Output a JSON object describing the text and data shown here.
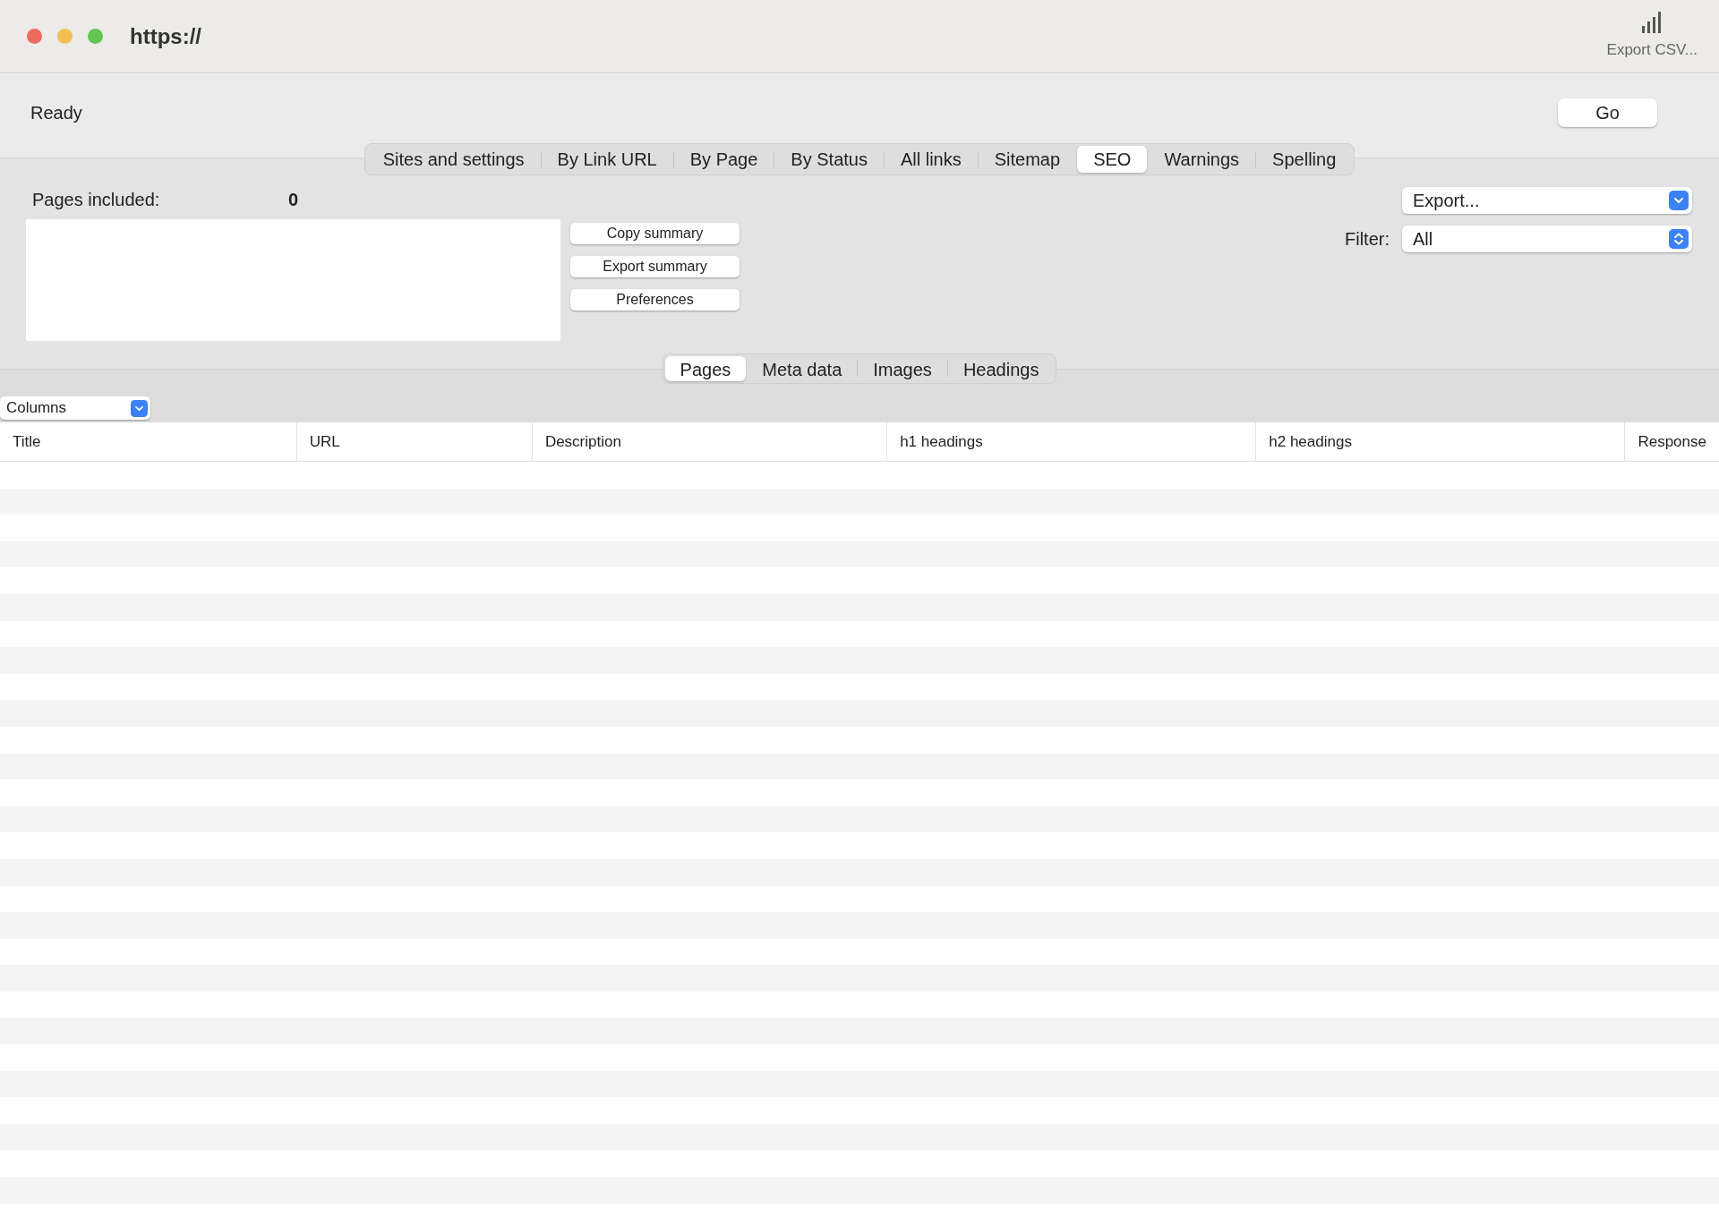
{
  "window": {
    "title": "https://"
  },
  "toolbar": {
    "export_label": "Export CSV..."
  },
  "status": {
    "text": "Ready",
    "go_button": "Go"
  },
  "tabs": [
    {
      "label": "Sites and settings",
      "selected": false
    },
    {
      "label": "By Link URL",
      "selected": false
    },
    {
      "label": "By Page",
      "selected": false
    },
    {
      "label": "By Status",
      "selected": false
    },
    {
      "label": "All links",
      "selected": false
    },
    {
      "label": "Sitemap",
      "selected": false
    },
    {
      "label": "SEO",
      "selected": true
    },
    {
      "label": "Warnings",
      "selected": false
    },
    {
      "label": "Spelling",
      "selected": false
    }
  ],
  "summary": {
    "label": "Pages included:",
    "count": "0",
    "buttons": [
      "Copy summary",
      "Export summary",
      "Preferences"
    ]
  },
  "export_select": {
    "value": "Export..."
  },
  "filter": {
    "label": "Filter:",
    "value": "All"
  },
  "subtabs": [
    {
      "label": "Pages",
      "selected": true
    },
    {
      "label": "Meta data",
      "selected": false
    },
    {
      "label": "Images",
      "selected": false
    },
    {
      "label": "Headings",
      "selected": false
    }
  ],
  "columns_select": {
    "value": "Columns"
  },
  "table": {
    "columns": [
      "Title",
      "URL",
      "Description",
      "h1 headings",
      "h2 headings",
      "Response"
    ]
  }
}
